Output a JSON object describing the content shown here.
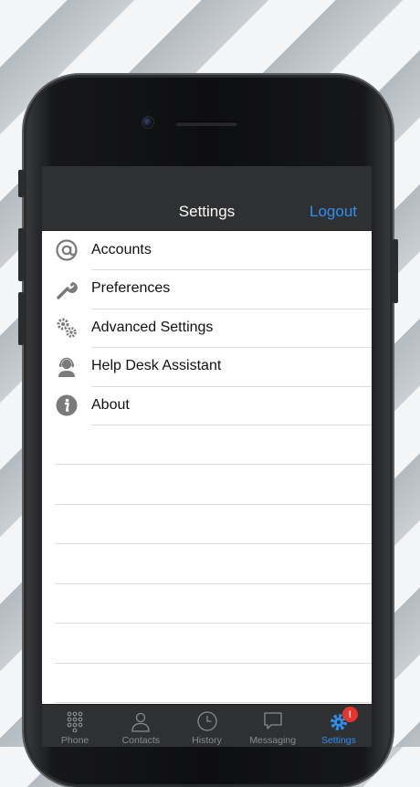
{
  "navbar": {
    "title": "Settings",
    "logout_label": "Logout"
  },
  "menu": [
    {
      "label": "Accounts",
      "icon": "at-icon"
    },
    {
      "label": "Preferences",
      "icon": "wrench-icon"
    },
    {
      "label": "Advanced Settings",
      "icon": "gears-icon"
    },
    {
      "label": "Help Desk Assistant",
      "icon": "support-agent-icon"
    },
    {
      "label": "About",
      "icon": "info-icon"
    }
  ],
  "tabs": [
    {
      "label": "Phone",
      "icon": "keypad-icon",
      "active": false
    },
    {
      "label": "Contacts",
      "icon": "contact-icon",
      "active": false
    },
    {
      "label": "History",
      "icon": "clock-icon",
      "active": false
    },
    {
      "label": "Messaging",
      "icon": "chat-bubble-icon",
      "active": false
    },
    {
      "label": "Settings",
      "icon": "gear-icon",
      "active": true,
      "badge": "!"
    }
  ],
  "colors": {
    "accent": "#2f8ff0",
    "bar": "#2f3032",
    "badge": "#e8342f"
  }
}
